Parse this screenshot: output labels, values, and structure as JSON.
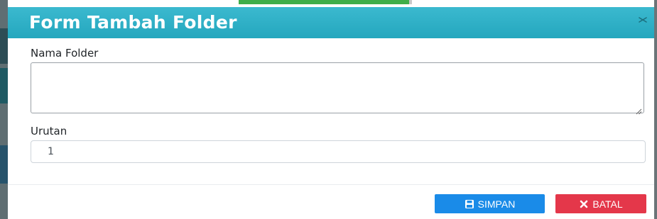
{
  "modal": {
    "title": "Form Tambah Folder",
    "close_icon": "close-icon"
  },
  "form": {
    "nama_folder": {
      "label": "Nama Folder",
      "value": ""
    },
    "urutan": {
      "label": "Urutan",
      "value": "1"
    }
  },
  "buttons": {
    "simpan": {
      "label": "SIMPAN",
      "icon": "save-icon",
      "color": "#1a8be8"
    },
    "batal": {
      "label": "BATAL",
      "icon": "close-icon",
      "color": "#e4374a"
    }
  },
  "colors": {
    "header": "#2bb0c7",
    "background_accent": "#3fae49"
  }
}
